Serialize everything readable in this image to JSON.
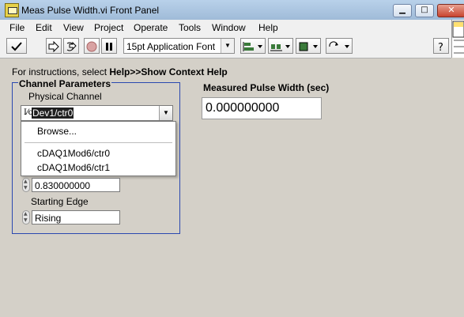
{
  "window": {
    "title": "Meas Pulse Width.vi Front Panel",
    "minimize_glyph": "▁",
    "maximize_glyph": "□",
    "close_glyph": "✕"
  },
  "menu": {
    "items": [
      "File",
      "Edit",
      "View",
      "Project",
      "Operate",
      "Tools",
      "Window",
      "Help"
    ]
  },
  "toolbar": {
    "font_select_value": "15pt Application Font",
    "icons": [
      "run-mode-icon",
      "run-arrow-icon",
      "run-continuously-icon",
      "abort-icon",
      "pause-icon",
      "align-icon",
      "distribute-icon",
      "resize-icon",
      "reorder-icon",
      "context-help-icon"
    ]
  },
  "panel": {
    "instructions_prefix": "For instructions, select ",
    "instructions_bold": "Help>>Show Context Help",
    "channel_group_title": "Channel Parameters",
    "physical_channel_label": "Physical Channel",
    "physical_channel_value": "Dev1/ctr0",
    "dropdown_items": [
      "Browse...",
      "cDAQ1Mod6/ctr0",
      "cDAQ1Mod6/ctr1"
    ],
    "numeric_value": "0.830000000",
    "starting_edge_label": "Starting Edge",
    "starting_edge_value": "Rising",
    "measured_label": "Measured Pulse Width (sec)",
    "measured_value": "0.000000000"
  },
  "colors": {
    "group_border": "#2a48b0",
    "panel_bg": "#d4d0c8",
    "highlight": "#1f1f1f"
  }
}
